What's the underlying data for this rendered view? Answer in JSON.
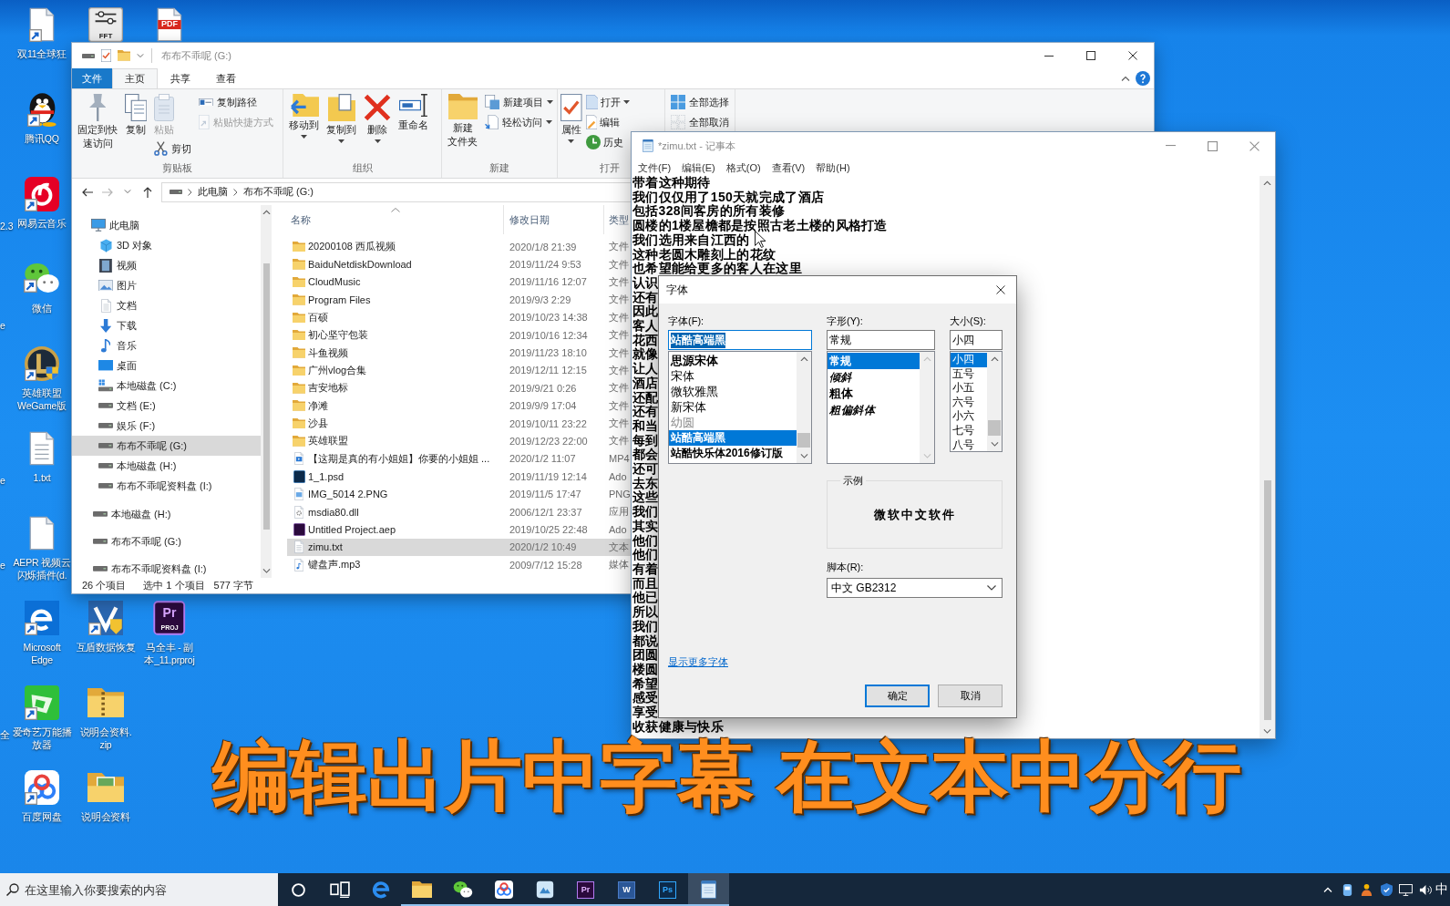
{
  "desktop": {
    "icons": [
      {
        "kind": "document",
        "label": "双11全球狂",
        "shortcut": true
      },
      {
        "kind": "penguin",
        "label": "腾讯QQ",
        "shortcut": true
      },
      {
        "kind": "music",
        "label": "网易云音乐",
        "shortcut": true
      },
      {
        "kind": "chat",
        "label": "微信",
        "shortcut": true
      },
      {
        "kind": "game",
        "label": "英雄联盟WeGame版",
        "shortcut": true
      },
      {
        "kind": "text-file",
        "label": "1.txt",
        "shortcut": false
      },
      {
        "kind": "document",
        "label": "AEPR 视频云闪烁插件(d.",
        "shortcut": false
      },
      {
        "kind": "edge",
        "label": "Microsoft Edge",
        "shortcut": true
      },
      {
        "kind": "player",
        "label": "爱奇艺万能播放器",
        "shortcut": true
      },
      {
        "kind": "cloud",
        "label": "百度网盘",
        "shortcut": true
      },
      {
        "kind": "sliders",
        "badges": [
          "FFT"
        ],
        "shortcut": false
      },
      {
        "kind": "recovery",
        "label": "互盾数据恢复",
        "shortcut": true
      },
      {
        "kind": "zip",
        "label": "说明会资料.zip",
        "shortcut": false
      },
      {
        "kind": "folder-pictures",
        "label": "说明会资料",
        "shortcut": false
      },
      {
        "kind": "pdf",
        "badges": [
          "PDF"
        ],
        "shortcut": false
      },
      {
        "kind": "premiere-project",
        "badges": [
          "Pr",
          "PROJ"
        ],
        "label": "马全丰 - 副本_11.prproj",
        "shortcut": false
      }
    ],
    "edge_labels": [
      "2.3",
      "e",
      "e",
      "e",
      "全"
    ]
  },
  "explorer": {
    "title": "布布不乖呢 (G:)",
    "tabs": [
      {
        "label": "文件",
        "kind": "menu",
        "selected": false
      },
      {
        "label": "主页",
        "kind": "tab",
        "selected": true
      },
      {
        "label": "共享",
        "kind": "tab",
        "selected": false
      },
      {
        "label": "查看",
        "kind": "tab",
        "selected": false
      }
    ],
    "ribbon": [
      {
        "label": "剪贴板",
        "columns": [
          [
            {
              "label": "固定到快速访问",
              "kind": "large",
              "disabled": false,
              "dropdown": false
            }
          ],
          [
            {
              "label": "复制",
              "kind": "large",
              "disabled": false,
              "dropdown": false
            }
          ],
          [
            {
              "label": "粘贴",
              "kind": "large",
              "disabled": true,
              "dropdown": false
            },
            {
              "label": "剪切",
              "kind": "small",
              "disabled": false,
              "dropdown": false
            }
          ],
          [
            {
              "label": "复制路径",
              "kind": "small",
              "disabled": false,
              "dropdown": false
            },
            {
              "label": "粘贴快捷方式",
              "kind": "small",
              "disabled": true,
              "dropdown": false
            }
          ]
        ]
      },
      {
        "label": "组织",
        "columns": [
          [
            {
              "label": "移动到",
              "kind": "large",
              "disabled": false,
              "dropdown": true
            }
          ],
          [
            {
              "label": "复制到",
              "kind": "large",
              "disabled": false,
              "dropdown": true
            }
          ],
          [
            {
              "label": "删除",
              "kind": "large",
              "disabled": false,
              "dropdown": true
            }
          ],
          [
            {
              "label": "重命名",
              "kind": "large",
              "disabled": false,
              "dropdown": false
            }
          ]
        ]
      },
      {
        "label": "新建",
        "columns": [
          [
            {
              "label": "新建文件夹",
              "kind": "large",
              "disabled": false,
              "dropdown": false
            }
          ],
          [
            {
              "label": "新建项目",
              "kind": "small",
              "disabled": false,
              "dropdown": true
            },
            {
              "label": "轻松访问",
              "kind": "small",
              "disabled": false,
              "dropdown": true
            }
          ]
        ]
      },
      {
        "label": "打开",
        "columns": [
          [
            {
              "label": "属性",
              "kind": "large",
              "disabled": false,
              "dropdown": true
            }
          ],
          [
            {
              "label": "打开",
              "kind": "small",
              "disabled": false,
              "dropdown": true
            },
            {
              "label": "编辑",
              "kind": "small",
              "disabled": false,
              "dropdown": false
            },
            {
              "label": "历史",
              "kind": "small",
              "disabled": false,
              "dropdown": false
            }
          ]
        ]
      },
      {
        "columns": [
          [
            {
              "label": "全部选择",
              "kind": "small",
              "disabled": false,
              "dropdown": false
            },
            {
              "label": "全部取消",
              "kind": "small",
              "disabled": false,
              "dropdown": false
            }
          ]
        ]
      }
    ],
    "path": [
      "此电脑",
      "布布不乖呢 (G:)"
    ],
    "nav": [
      {
        "label": "此电脑",
        "kind": "pc",
        "selected": false,
        "children": [
          {
            "label": "3D 对象",
            "kind": "objects",
            "selected": false
          },
          {
            "label": "视频",
            "kind": "video",
            "selected": false
          },
          {
            "label": "图片",
            "kind": "pictures",
            "selected": false
          },
          {
            "label": "文档",
            "kind": "documents",
            "selected": false
          },
          {
            "label": "下载",
            "kind": "downloads",
            "selected": false
          },
          {
            "label": "音乐",
            "kind": "music",
            "selected": false
          },
          {
            "label": "桌面",
            "kind": "desktop",
            "selected": false
          },
          {
            "label": "本地磁盘 (C:)",
            "kind": "system",
            "selected": false
          },
          {
            "label": "文档 (E:)",
            "kind": "drive",
            "selected": false
          },
          {
            "label": "娱乐 (F:)",
            "kind": "drive",
            "selected": false
          },
          {
            "label": "布布不乖呢 (G:)",
            "kind": "drive",
            "selected": true
          },
          {
            "label": "本地磁盘 (H:)",
            "kind": "drive",
            "selected": false
          },
          {
            "label": "布布不乖呢资料盘 (I:)",
            "kind": "drive",
            "selected": false
          }
        ]
      },
      {
        "label": "本地磁盘 (H:)",
        "kind": "drive",
        "selected": false
      },
      {
        "label": "布布不乖呢 (G:)",
        "kind": "drive",
        "selected": false
      },
      {
        "label": "布布不乖呢资料盘 (I:)",
        "kind": "drive",
        "selected": false
      }
    ],
    "columns": [
      "名称",
      "修改日期",
      "类型"
    ],
    "files": [
      {
        "name": "20200108 西瓜视频",
        "modified": "2020/1/8 21:39",
        "type": "文件",
        "kind": "folder",
        "selected": false
      },
      {
        "name": "BaiduNetdiskDownload",
        "modified": "2019/11/24 9:53",
        "type": "文件",
        "kind": "folder",
        "selected": false
      },
      {
        "name": "CloudMusic",
        "modified": "2019/11/16 12:07",
        "type": "文件",
        "kind": "folder",
        "selected": false
      },
      {
        "name": "Program Files",
        "modified": "2019/9/3 2:29",
        "type": "文件",
        "kind": "folder",
        "selected": false
      },
      {
        "name": "百硕",
        "modified": "2019/10/23 14:38",
        "type": "文件",
        "kind": "folder",
        "selected": false
      },
      {
        "name": "初心坚守包装",
        "modified": "2019/10/16 12:34",
        "type": "文件",
        "kind": "folder",
        "selected": false
      },
      {
        "name": "斗鱼视频",
        "modified": "2019/11/23 18:10",
        "type": "文件",
        "kind": "folder",
        "selected": false
      },
      {
        "name": "广州vlog合集",
        "modified": "2019/12/11 12:15",
        "type": "文件",
        "kind": "folder",
        "selected": false
      },
      {
        "name": "吉安地标",
        "modified": "2019/9/21 0:26",
        "type": "文件",
        "kind": "folder",
        "selected": false
      },
      {
        "name": "净滩",
        "modified": "2019/9/9 17:04",
        "type": "文件",
        "kind": "folder",
        "selected": false
      },
      {
        "name": "沙县",
        "modified": "2019/10/11 23:22",
        "type": "文件",
        "kind": "folder",
        "selected": false
      },
      {
        "name": "英雄联盟",
        "modified": "2019/12/23 22:00",
        "type": "文件",
        "kind": "folder",
        "selected": false
      },
      {
        "name": "【这期是真的有小姐姐】你要的小姐姐 ...",
        "modified": "2020/1/2 11:07",
        "type": "MP4",
        "kind": "video",
        "selected": false
      },
      {
        "name": "1_1.psd",
        "modified": "2019/11/19 12:14",
        "type": "Ado",
        "kind": "psd",
        "selected": false
      },
      {
        "name": "IMG_5014 2.PNG",
        "modified": "2019/11/5 17:47",
        "type": "PNG",
        "kind": "image",
        "selected": false
      },
      {
        "name": "msdia80.dll",
        "modified": "2006/12/1 23:37",
        "type": "应用",
        "kind": "dll",
        "selected": false
      },
      {
        "name": "Untitled Project.aep",
        "modified": "2019/10/25 22:48",
        "type": "Ado",
        "kind": "aep",
        "selected": false
      },
      {
        "name": "zimu.txt",
        "modified": "2020/1/2 10:49",
        "type": "文本",
        "kind": "text",
        "selected": true
      },
      {
        "name": "键盘声.mp3",
        "modified": "2009/7/12 15:28",
        "type": "媒体",
        "kind": "audio",
        "selected": false
      }
    ],
    "status": [
      "26 个项目",
      "选中 1 个项目",
      "577 字节"
    ]
  },
  "notepad": {
    "title": "*zimu.txt - 记事本",
    "menu": [
      "文件(F)",
      "编辑(E)",
      "格式(O)",
      "查看(V)",
      "帮助(H)"
    ],
    "lines": [
      "带着这种期待",
      "我们仅仅用了150天就完成了酒店",
      "包括328间客房的所有装修",
      "圆楼的1楼屋檐都是按照古老土楼的风格打造",
      "我们选用来自江西的",
      "这种老圆木雕刻上的花纹",
      "也希望能给更多的客人在这里",
      "认识",
      "还有",
      "因此",
      "客人",
      "花西",
      "就像",
      "让人",
      "酒店",
      "还配",
      "还有",
      "和当",
      "每到",
      "都会",
      "还可",
      "去东",
      "这些",
      "我们",
      "其实",
      "他们",
      "他们",
      "有着",
      "而且",
      "他已",
      "所以",
      "我们",
      "都说",
      "团圆",
      "楼圆",
      "希望",
      "感受",
      "享受",
      "收获健康与快乐"
    ]
  },
  "font_dialog": {
    "title": "字体",
    "font": {
      "label": "字体(F):",
      "value": "站酷高端黑",
      "highlighted": true,
      "items": [
        {
          "text": "思源宋体",
          "kind": "bold",
          "selected": false
        },
        {
          "text": "宋体",
          "kind": "serif",
          "selected": false
        },
        {
          "text": "微软雅黑",
          "kind": "sans",
          "selected": false
        },
        {
          "text": "新宋体",
          "kind": "serif",
          "selected": false
        },
        {
          "text": "幼圆",
          "kind": "light",
          "selected": false
        },
        {
          "text": "站酷高端黑",
          "kind": "display",
          "selected": true
        },
        {
          "text": "站酷快乐体2016修订版",
          "kind": "display",
          "selected": false
        }
      ]
    },
    "style": {
      "label": "字形(Y):",
      "value": "常规",
      "highlighted": false,
      "items": [
        {
          "text": "常规",
          "kind": "regular",
          "selected": true
        },
        {
          "text": "倾斜",
          "kind": "italic",
          "selected": false
        },
        {
          "text": "粗体",
          "kind": "bold",
          "selected": false
        },
        {
          "text": "粗偏斜体",
          "kind": "bolditalic",
          "selected": false
        }
      ]
    },
    "size": {
      "label": "大小(S):",
      "value": "小四",
      "highlighted": false,
      "items": [
        {
          "text": "小四",
          "selected": true
        },
        {
          "text": "五号",
          "selected": false
        },
        {
          "text": "小五",
          "selected": false
        },
        {
          "text": "六号",
          "selected": false
        },
        {
          "text": "小六",
          "selected": false
        },
        {
          "text": "七号",
          "selected": false
        },
        {
          "text": "八号",
          "selected": false
        }
      ]
    },
    "sample": {
      "label": "示例",
      "text": "微软中文软件"
    },
    "script": {
      "label": "脚本(R):",
      "value": "中文 GB2312"
    },
    "more_fonts_link": "显示更多字体",
    "buttons": [
      {
        "label": "确定",
        "default": true
      },
      {
        "label": "取消",
        "default": false
      }
    ]
  },
  "subtitle": "编辑出片中字幕 在文本中分行",
  "taskbar": {
    "search": {
      "placeholder": "在这里输入你要搜索的内容"
    },
    "apps": [
      {
        "kind": "cortana",
        "running": false,
        "selected": false
      },
      {
        "kind": "taskview",
        "running": false,
        "selected": false
      },
      {
        "kind": "edge",
        "running": false,
        "selected": false
      },
      {
        "kind": "explorer",
        "running": true,
        "selected": false
      },
      {
        "kind": "wechat",
        "running": true,
        "selected": false
      },
      {
        "kind": "netdisk",
        "running": true,
        "selected": false
      },
      {
        "kind": "app",
        "running": true,
        "selected": false
      },
      {
        "kind": "premiere",
        "badge": "Pr",
        "running": true,
        "selected": false
      },
      {
        "kind": "word",
        "badge": "W",
        "running": true,
        "selected": false
      },
      {
        "kind": "photoshop",
        "badge": "Ps",
        "running": true,
        "selected": false
      },
      {
        "kind": "notepad",
        "running": true,
        "selected": true
      }
    ],
    "ime": "中"
  }
}
